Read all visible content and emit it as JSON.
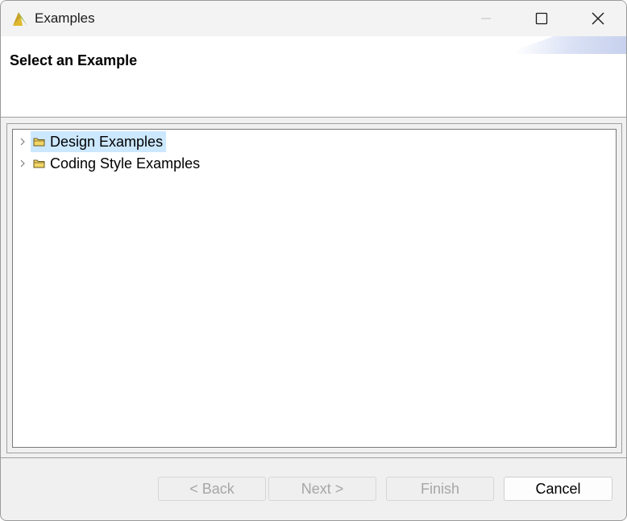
{
  "window": {
    "title": "Examples",
    "app_icon": "vivado-logo-icon"
  },
  "header": {
    "title": "Select an Example"
  },
  "tree": {
    "items": [
      {
        "label": "Design Examples",
        "icon": "folder-icon",
        "expanded": false,
        "selected": true
      },
      {
        "label": "Coding Style Examples",
        "icon": "folder-icon",
        "expanded": false,
        "selected": false
      }
    ]
  },
  "buttons": {
    "back": "< Back",
    "next": "Next >",
    "finish": "Finish",
    "cancel": "Cancel"
  },
  "colors": {
    "selection": "#cce8ff",
    "folder": "#e8c84a",
    "disabled_text": "#a6a6a6"
  }
}
